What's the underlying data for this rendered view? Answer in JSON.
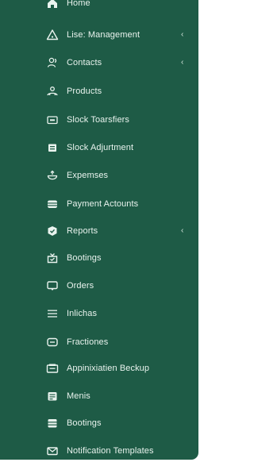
{
  "sidebar": {
    "items": [
      {
        "label": "Home",
        "icon": "home-icon",
        "has_submenu": false
      },
      {
        "label": "Lise: Management",
        "icon": "warning-triangle-icon",
        "has_submenu": true
      },
      {
        "label": "Contacts",
        "icon": "users-icon",
        "has_submenu": true
      },
      {
        "label": "Products",
        "icon": "products-icon",
        "has_submenu": false
      },
      {
        "label": "Slock Toarsfiers",
        "icon": "transfer-card-icon",
        "has_submenu": false
      },
      {
        "label": "Slock Adjurtment",
        "icon": "adjustment-box-icon",
        "has_submenu": false
      },
      {
        "label": "Expemses",
        "icon": "expense-icon",
        "has_submenu": false
      },
      {
        "label": "Payment Actounts",
        "icon": "wallet-icon",
        "has_submenu": false
      },
      {
        "label": "Reports",
        "icon": "reports-icon",
        "has_submenu": true
      },
      {
        "label": "Bootings",
        "icon": "booking-icon",
        "has_submenu": false
      },
      {
        "label": "Orders",
        "icon": "chat-bubble-icon",
        "has_submenu": false
      },
      {
        "label": "Inlichas",
        "icon": "menu-lines-icon",
        "has_submenu": false
      },
      {
        "label": "Fractiones",
        "icon": "tag-icon",
        "has_submenu": false
      },
      {
        "label": "Appinixiatien Beckup",
        "icon": "backup-icon",
        "has_submenu": false
      },
      {
        "label": "Menis",
        "icon": "menus-icon",
        "has_submenu": false
      },
      {
        "label": "Bootings",
        "icon": "stack-icon",
        "has_submenu": false
      },
      {
        "label": "Notification Templates",
        "icon": "envelope-icon",
        "has_submenu": false
      }
    ],
    "chevron": "‹"
  },
  "colors": {
    "sidebar_background": "#1e5b46",
    "text": "#e9f3ee",
    "page_background": "#ffffff"
  }
}
